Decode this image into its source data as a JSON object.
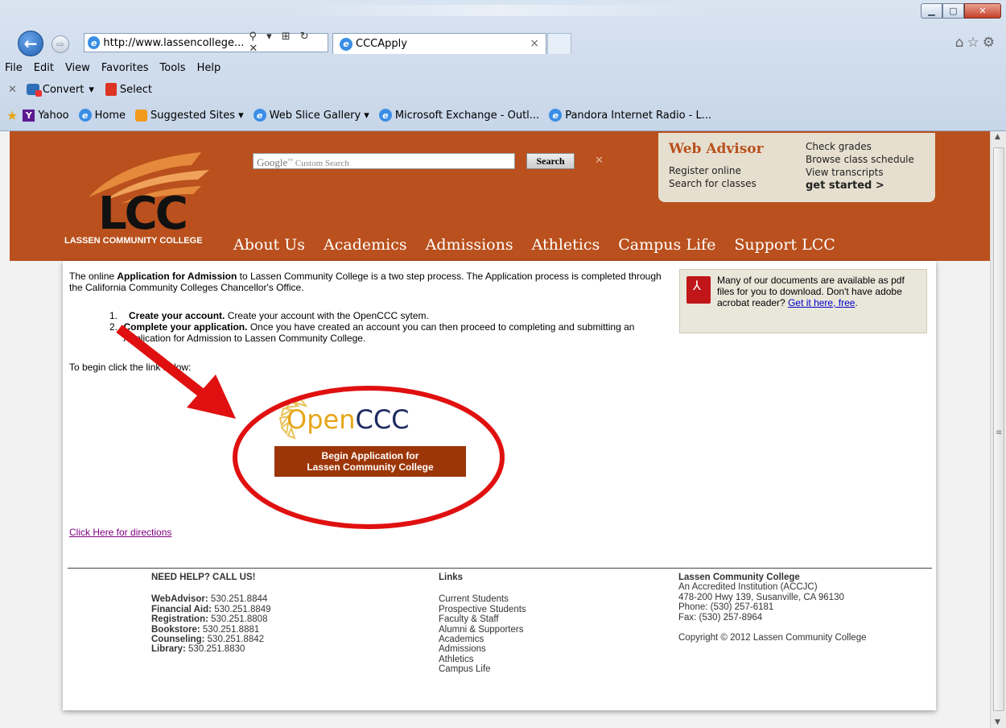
{
  "browser": {
    "address": "http://www.lassencollege...",
    "address_tools": "⚲ ▾ ⊞ ↻ ✕",
    "tab_title": "CCCApply",
    "menu": [
      "File",
      "Edit",
      "View",
      "Favorites",
      "Tools",
      "Help"
    ],
    "cmd_convert": "Convert",
    "cmd_select": "Select",
    "favorites": {
      "yahoo": "Yahoo",
      "home": "Home",
      "suggested": "Suggested Sites ▾",
      "webslice": "Web Slice Gallery ▾",
      "exchange": "Microsoft Exchange - Outl...",
      "pandora": "Pandora Internet Radio - L..."
    }
  },
  "site": {
    "logo": "LCC",
    "logo_sub": "LASSEN COMMUNITY COLLEGE",
    "search_placeholder_brand": "Google",
    "search_placeholder": "Custom Search",
    "search_button": "Search",
    "webadvisor": {
      "title": "Web Advisor",
      "left": [
        "Register online",
        "Search for classes"
      ],
      "right": [
        "Check grades",
        "Browse class schedule",
        "View transcripts"
      ],
      "cta": "get started >"
    },
    "nav": [
      "About Us",
      "Academics",
      "Admissions",
      "Athletics",
      "Campus Life",
      "Support LCC"
    ]
  },
  "content": {
    "intro_pre": "The online ",
    "intro_bold": "Application for Admission",
    "intro_post": " to Lassen Community College is a two step process.  The Application process is completed through the California Community Colleges Chancellor's Office.",
    "step1_num": "1.",
    "step1_bold": "Create your account.",
    "step1_text": " Create your account with the OpenCCC sytem.",
    "step2_num": "2.",
    "step2_bold": "Complete your application.",
    "step2_text": " Once you have created an account you can then proceed to completing and submitting an Application for Admission to Lassen Community College.",
    "begin_text": "To begin click the link below:",
    "pdf_text": "Many of our documents are available as pdf files for you to download. Don't have adobe acrobat reader? ",
    "pdf_link": "Get it here, free",
    "pdf_period": ".",
    "opencc_open": "Open",
    "opencc_ccc": "CCC",
    "begin_button_line1": "Begin Application for",
    "begin_button_line2": "Lassen Community College",
    "directions_link": "Click Here for directions"
  },
  "footer": {
    "help_title": "NEED HELP? CALL US!",
    "contacts": [
      {
        "label": "WebAdvisor:",
        "value": "530.251.8844"
      },
      {
        "label": "Financial Aid:",
        "value": "530.251.8849"
      },
      {
        "label": "Registration:",
        "value": "530.251.8808"
      },
      {
        "label": "Bookstore:",
        "value": "530.251.8881"
      },
      {
        "label": "Counseling:",
        "value": "530.251.8842"
      },
      {
        "label": "Library:",
        "value": "530.251.8830"
      }
    ],
    "links_title": "Links",
    "links": [
      "Current Students",
      "Prospective Students",
      "Faculty & Staff",
      "Alumni & Supporters",
      "Academics",
      "Admissions",
      "Athletics",
      "Campus Life"
    ],
    "college_title": "Lassen Community College",
    "college_lines": [
      "An Accredited Institution (ACCJC)",
      "478-200 Hwy 139, Susanville, CA 96130",
      "Phone: (530) 257-6181",
      "Fax: (530) 257-8964"
    ],
    "copyright": "Copyright © 2012 Lassen Community College"
  },
  "colors": {
    "brand_orange": "#b9501d",
    "button_brown": "#9c3608",
    "annotation_red": "#e01010"
  }
}
